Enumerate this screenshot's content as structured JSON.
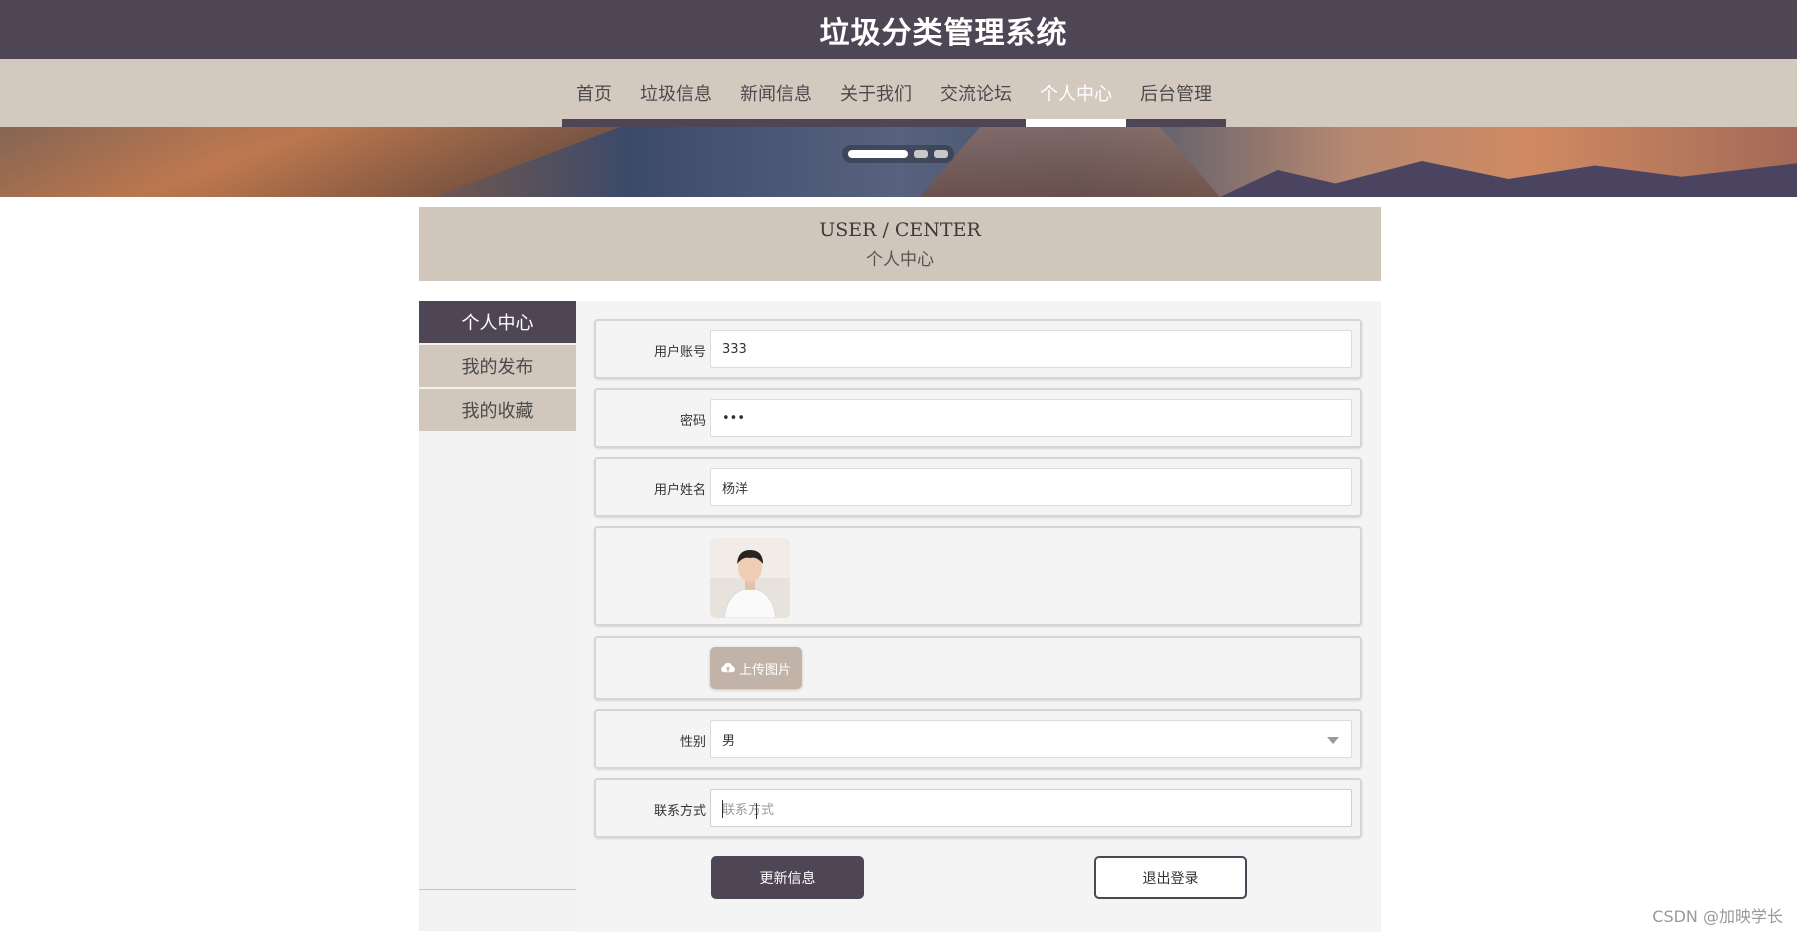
{
  "header": {
    "title": "垃圾分类管理系统"
  },
  "nav": {
    "items": [
      {
        "label": "首页"
      },
      {
        "label": "垃圾信息"
      },
      {
        "label": "新闻信息"
      },
      {
        "label": "关于我们"
      },
      {
        "label": "交流论坛"
      },
      {
        "label": "个人中心",
        "active": true
      },
      {
        "label": "后台管理"
      }
    ]
  },
  "banner": {
    "slides": 3,
    "active_slide": 1
  },
  "section": {
    "title_en": "USER / CENTER",
    "title_cn": "个人中心"
  },
  "sidebar": {
    "items": [
      {
        "label": "个人中心",
        "active": true
      },
      {
        "label": "我的发布"
      },
      {
        "label": "我的收藏"
      }
    ]
  },
  "form": {
    "account": {
      "label": "用户账号",
      "value": "333"
    },
    "password": {
      "label": "密码",
      "value": "•••"
    },
    "name": {
      "label": "用户姓名",
      "value": "杨洋"
    },
    "upload": {
      "label": "上传图片"
    },
    "gender": {
      "label": "性别",
      "value": "男"
    },
    "contact": {
      "label": "联系方式",
      "placeholder": "联系方式"
    }
  },
  "buttons": {
    "update": "更新信息",
    "logout": "退出登录"
  },
  "watermark": "CSDN @加映学长",
  "colors": {
    "primary": "#4e4654",
    "nav_bg": "#d3c9bf",
    "section_bg": "#d0c6bc"
  }
}
